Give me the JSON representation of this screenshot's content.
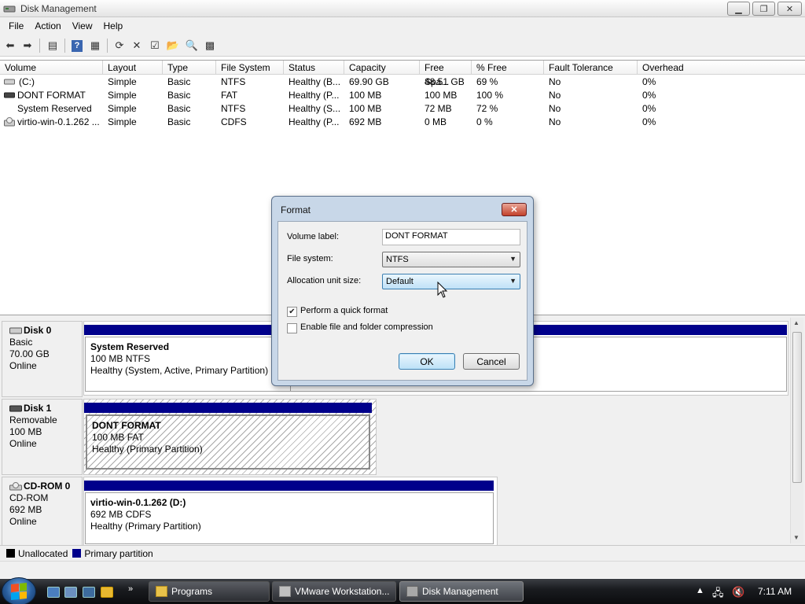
{
  "window": {
    "title": "Disk Management"
  },
  "menu": {
    "file": "File",
    "action": "Action",
    "view": "View",
    "help": "Help"
  },
  "volume_list": {
    "columns": [
      "Volume",
      "Layout",
      "Type",
      "File System",
      "Status",
      "Capacity",
      "Free Spa...",
      "% Free",
      "Fault Tolerance",
      "Overhead"
    ],
    "rows": [
      [
        "(C:)",
        "Simple",
        "Basic",
        "NTFS",
        "Healthy (B...",
        "69.90 GB",
        "48.51 GB",
        "69 %",
        "No",
        "0%"
      ],
      [
        "DONT FORMAT",
        "Simple",
        "Basic",
        "FAT",
        "Healthy (P...",
        "100 MB",
        "100 MB",
        "100 %",
        "No",
        "0%"
      ],
      [
        "System Reserved",
        "Simple",
        "Basic",
        "NTFS",
        "Healthy (S...",
        "100 MB",
        "72 MB",
        "72 %",
        "No",
        "0%"
      ],
      [
        "virtio-win-0.1.262 ...",
        "Simple",
        "Basic",
        "CDFS",
        "Healthy (P...",
        "692 MB",
        "0 MB",
        "0 %",
        "No",
        "0%"
      ]
    ]
  },
  "disks": [
    {
      "name": "Disk 0",
      "type": "Basic",
      "size": "70.00 GB",
      "state": "Online",
      "partition": {
        "name": "System Reserved",
        "size": "100 MB NTFS",
        "status": "Healthy (System, Active, Primary Partition)"
      }
    },
    {
      "name": "Disk 1",
      "type": "Removable",
      "size": "100 MB",
      "state": "Online",
      "partition": {
        "name": "DONT FORMAT",
        "size": "100 MB FAT",
        "status": "Healthy (Primary Partition)"
      }
    },
    {
      "name": "CD-ROM 0",
      "type": "CD-ROM",
      "size": "692 MB",
      "state": "Online",
      "partition": {
        "name": "virtio-win-0.1.262  (D:)",
        "size": "692 MB CDFS",
        "status": "Healthy (Primary Partition)"
      }
    }
  ],
  "legend": {
    "unallocated": "Unallocated",
    "primary": "Primary partition"
  },
  "dialog": {
    "title": "Format",
    "volume_label": "Volume label:",
    "volume_label_value": "DONT FORMAT",
    "file_system": "File system:",
    "file_system_value": "NTFS",
    "alloc_unit": "Allocation unit size:",
    "alloc_unit_value": "Default",
    "quick_format": "Perform a quick format",
    "quick_format_checked": true,
    "compression": "Enable file and folder compression",
    "compression_checked": false,
    "ok": "OK",
    "cancel": "Cancel"
  },
  "taskbar": {
    "buttons": [
      "Programs",
      "VMware Workstation...",
      "Disk Management"
    ],
    "clock": "7:11 AM"
  },
  "colors": {
    "primary_partition": "#00008b",
    "unallocated": "#000000",
    "dialog_frame": "#c8d7e8"
  }
}
